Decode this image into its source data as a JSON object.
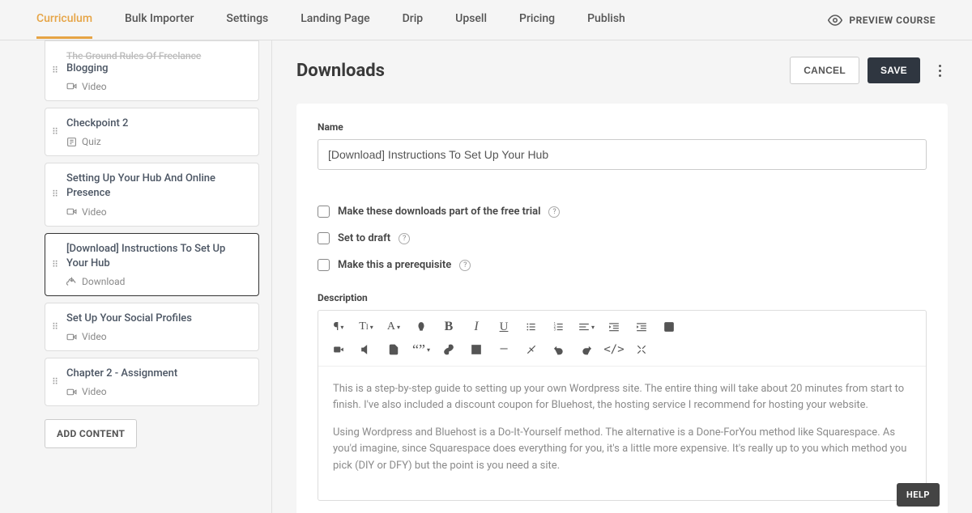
{
  "nav": {
    "tabs": [
      "Curriculum",
      "Bulk Importer",
      "Settings",
      "Landing Page",
      "Drip",
      "Upsell",
      "Pricing",
      "Publish"
    ],
    "active": 0,
    "preview": "PREVIEW COURSE"
  },
  "sidebar": {
    "lessons": [
      {
        "title": "The Ground Rules Of Freelance Blogging",
        "type": "Video",
        "truncated": true
      },
      {
        "title": "Checkpoint 2",
        "type": "Quiz"
      },
      {
        "title": "Setting Up Your Hub And Online Presence",
        "type": "Video"
      },
      {
        "title": "[Download] Instructions To Set Up Your Hub",
        "type": "Download",
        "active": true
      },
      {
        "title": "Set Up Your Social Profiles",
        "type": "Video"
      },
      {
        "title": "Chapter 2 - Assignment",
        "type": "Video"
      }
    ],
    "add_content": "ADD CONTENT"
  },
  "main": {
    "title": "Downloads",
    "cancel": "CANCEL",
    "save": "SAVE",
    "name_label": "Name",
    "name_value": "[Download] Instructions To Set Up Your Hub",
    "checks": {
      "free_trial": "Make these downloads part of the free trial",
      "draft": "Set to draft",
      "prereq": "Make this a prerequisite"
    },
    "description_label": "Description",
    "description_p1": "This is a step-by-step guide to setting up your own Wordpress site. The entire thing will take about 20 minutes from start to finish. I've also included a discount coupon for Bluehost, the hosting service I recommend for hosting your website.",
    "description_p2": "Using Wordpress and Bluehost is a Do-It-Yourself method. The alternative is a Done-ForYou method like Squarespace. As you'd imagine, since Squarespace does everything for you, it's a little more expensive. It's really up to you which method you pick (DIY or DFY) but the point is you need a site."
  },
  "help": "HELP"
}
